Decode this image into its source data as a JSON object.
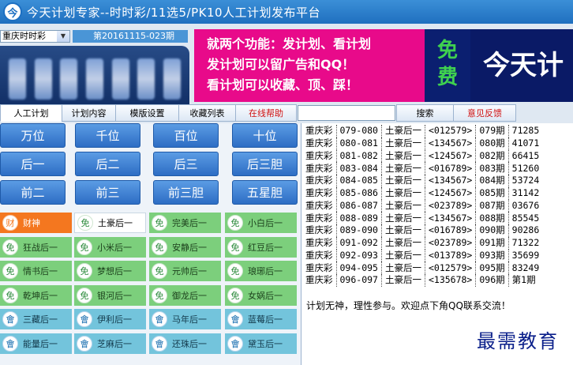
{
  "window": {
    "title": "今天计划专家--时时彩/11选5/PK10人工计划发布平台",
    "logo_glyph": "今"
  },
  "selector": {
    "lottery": "重庆时时彩",
    "issue": "第20161115-023期"
  },
  "banner": {
    "lines": [
      "就两个功能：发计划、看计划",
      "发计划可以留广告和QQ！",
      "看计划可以收藏、顶、踩！"
    ],
    "free": [
      "免",
      "费"
    ],
    "brand": "今天计"
  },
  "tabs": {
    "manual_plan": "人工计划",
    "plan_content": "计划内容",
    "template_settings": "模版设置",
    "favorites": "收藏列表",
    "online_help": "在线帮助",
    "search": "搜索",
    "feedback": "意见反馈"
  },
  "search": {
    "value": ""
  },
  "positions": [
    "万位",
    "千位",
    "百位",
    "十位",
    "后一",
    "后二",
    "后三",
    "后三胆",
    "前二",
    "前三",
    "前三胆",
    "五星胆"
  ],
  "plans": [
    {
      "icon": "财",
      "label": "财神",
      "style": "orange"
    },
    {
      "icon": "免",
      "label": "土豪后一",
      "style": "selected"
    },
    {
      "icon": "免",
      "label": "完美后一",
      "style": "green"
    },
    {
      "icon": "免",
      "label": "小白后一",
      "style": "green"
    },
    {
      "icon": "免",
      "label": "狂战后一",
      "style": "green"
    },
    {
      "icon": "免",
      "label": "小米后一",
      "style": "green"
    },
    {
      "icon": "免",
      "label": "安静后一",
      "style": "green"
    },
    {
      "icon": "免",
      "label": "红豆后一",
      "style": "green"
    },
    {
      "icon": "免",
      "label": "情书后一",
      "style": "green"
    },
    {
      "icon": "免",
      "label": "梦想后一",
      "style": "green"
    },
    {
      "icon": "免",
      "label": "元帅后一",
      "style": "green"
    },
    {
      "icon": "免",
      "label": "琅琊后一",
      "style": "green"
    },
    {
      "icon": "免",
      "label": "乾坤后一",
      "style": "green"
    },
    {
      "icon": "免",
      "label": "银河后一",
      "style": "green"
    },
    {
      "icon": "免",
      "label": "御龙后一",
      "style": "green"
    },
    {
      "icon": "免",
      "label": "女娲后一",
      "style": "green"
    },
    {
      "icon": "會",
      "label": "三藏后一",
      "style": "blue"
    },
    {
      "icon": "會",
      "label": "伊利后一",
      "style": "blue"
    },
    {
      "icon": "會",
      "label": "马年后一",
      "style": "blue"
    },
    {
      "icon": "會",
      "label": "蓝莓后一",
      "style": "blue"
    },
    {
      "icon": "會",
      "label": "能量后一",
      "style": "blue"
    },
    {
      "icon": "會",
      "label": "芝麻后一",
      "style": "blue"
    },
    {
      "icon": "會",
      "label": "还珠后一",
      "style": "blue"
    },
    {
      "icon": "會",
      "label": "黛玉后一",
      "style": "blue"
    }
  ],
  "plan_rows": [
    [
      "重庆彩",
      "079-080",
      "土豪后一",
      "<012579>",
      "079期",
      "71285"
    ],
    [
      "重庆彩",
      "080-081",
      "土豪后一",
      "<134567>",
      "080期",
      "41071"
    ],
    [
      "重庆彩",
      "081-082",
      "土豪后一",
      "<124567>",
      "082期",
      "66415"
    ],
    [
      "重庆彩",
      "083-084",
      "土豪后一",
      "<016789>",
      "083期",
      "51260"
    ],
    [
      "重庆彩",
      "084-085",
      "土豪后一",
      "<134567>",
      "084期",
      "53724"
    ],
    [
      "重庆彩",
      "085-086",
      "土豪后一",
      "<124567>",
      "085期",
      "31142"
    ],
    [
      "重庆彩",
      "086-087",
      "土豪后一",
      "<023789>",
      "087期",
      "03676"
    ],
    [
      "重庆彩",
      "088-089",
      "土豪后一",
      "<134567>",
      "088期",
      "85545"
    ],
    [
      "重庆彩",
      "089-090",
      "土豪后一",
      "<016789>",
      "090期",
      "90286"
    ],
    [
      "重庆彩",
      "091-092",
      "土豪后一",
      "<023789>",
      "091期",
      "71322"
    ],
    [
      "重庆彩",
      "092-093",
      "土豪后一",
      "<013789>",
      "093期",
      "35699"
    ],
    [
      "重庆彩",
      "094-095",
      "土豪后一",
      "<012579>",
      "095期",
      "83249"
    ],
    [
      "重庆彩",
      "096-097",
      "土豪后一",
      "<135678>",
      "096期",
      "第1期"
    ]
  ],
  "plan_note": "计划无神，理性参与。欢迎点下角QQ联系交流！",
  "watermark": "最需教育",
  "colors": {
    "title_bar": "#2a7fd0",
    "plan_green": "#7ccf7c",
    "plan_blue": "#73c4dc",
    "plan_orange": "#f4771f",
    "position_button": "#3b7fd2",
    "banner_pink": "#e80a8a"
  }
}
